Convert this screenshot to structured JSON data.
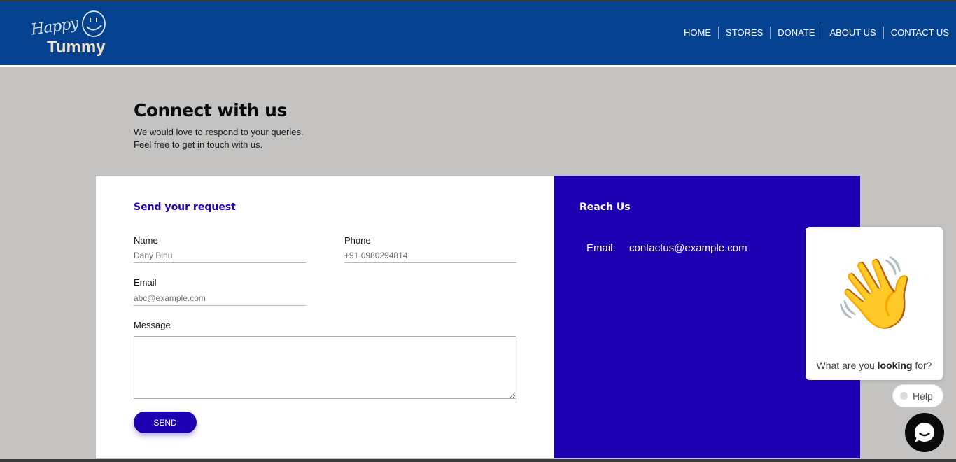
{
  "brand": {
    "script_text": "Happy",
    "name": "Tummy"
  },
  "nav": {
    "items": [
      {
        "label": "HOME"
      },
      {
        "label": "STORES"
      },
      {
        "label": "DONATE"
      },
      {
        "label": "ABOUT US"
      },
      {
        "label": "CONTACT US"
      }
    ]
  },
  "page": {
    "title": "Connect with us",
    "subtitle_line1": "We would love to respond to your queries.",
    "subtitle_line2": "Feel free to get in touch with us."
  },
  "form": {
    "heading": "Send your request",
    "name_label": "Name",
    "name_placeholder": "Dany Binu",
    "phone_label": "Phone",
    "phone_placeholder": "+91 0980294814",
    "email_label": "Email",
    "email_placeholder": "abc@example.com",
    "message_label": "Message",
    "send_label": "SEND"
  },
  "reach": {
    "heading": "Reach Us",
    "email_label": "Email:",
    "email_value": "contactus@example.com"
  },
  "widget": {
    "emoji": "👋",
    "question_pre": "What are you ",
    "question_bold": "looking",
    "question_post": " for?",
    "help_label": "Help"
  },
  "colors": {
    "header": "#04418f",
    "accent": "#1e00b3",
    "page_bg": "#c4c3c1"
  }
}
